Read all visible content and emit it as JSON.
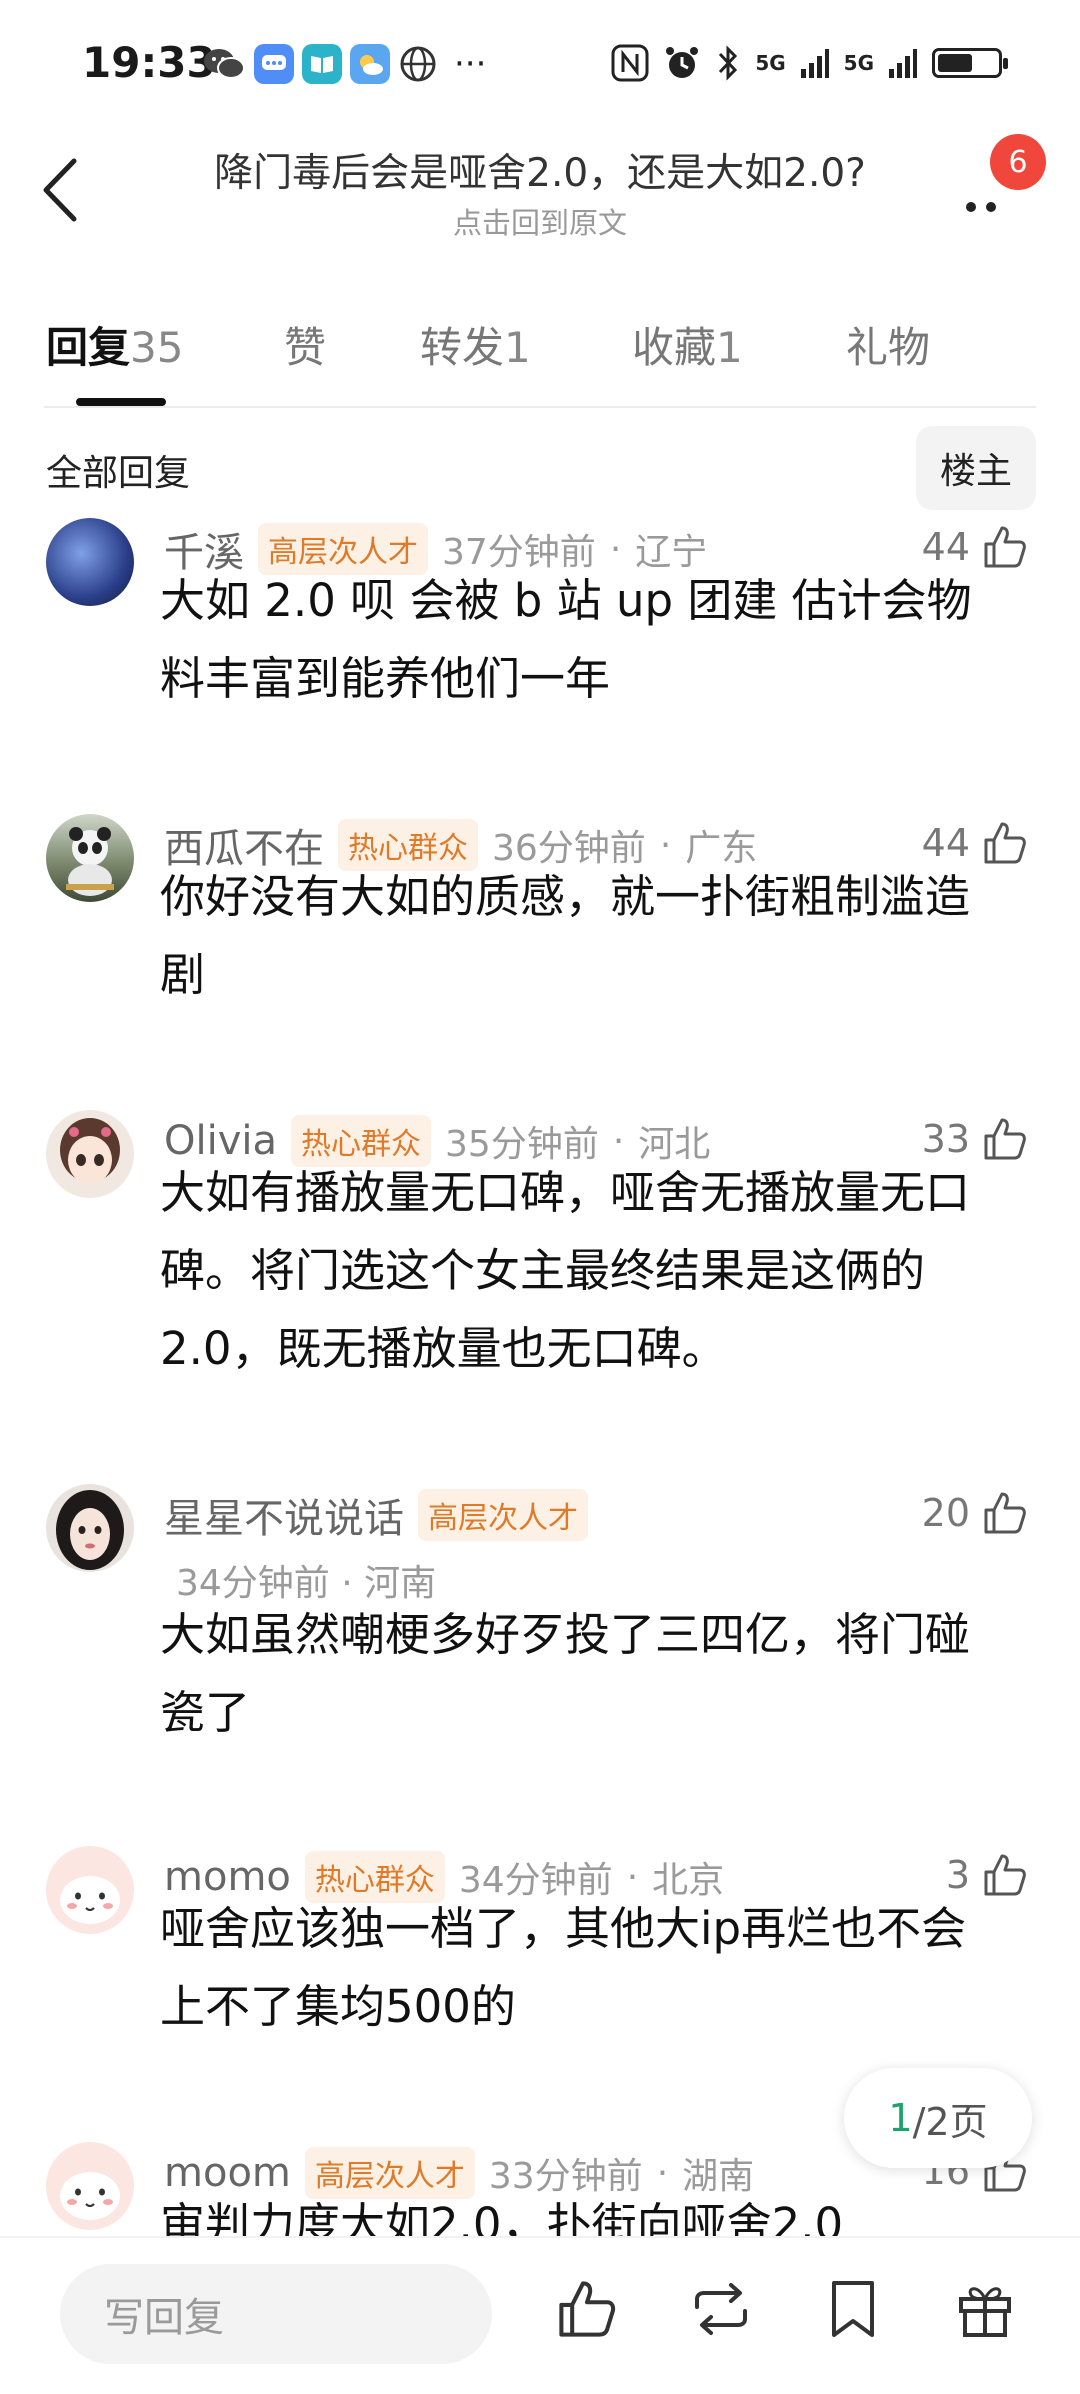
{
  "status_bar": {
    "time": "19:33",
    "dots": "···",
    "signal1": "5G",
    "signal2": "5G"
  },
  "header": {
    "title": "降门毒后会是哑舍2.0，还是大如2.0?",
    "subtitle": "点击回到原文",
    "notification_count": "6"
  },
  "tabs": [
    {
      "label": "回复",
      "count": "35"
    },
    {
      "label": "赞",
      "count": ""
    },
    {
      "label": "转发",
      "count": "1"
    },
    {
      "label": "收藏",
      "count": "1"
    },
    {
      "label": "礼物",
      "count": ""
    }
  ],
  "filter": {
    "all_replies": "全部回复",
    "op_only": "楼主"
  },
  "comments": [
    {
      "name": "千溪",
      "rank": "高层次人才",
      "time": "37分钟前",
      "location": "辽宁",
      "likes": "44",
      "lines": [
        "大如 2.0 呗 会被 b 站 up 团建 估计会物",
        "料丰富到能养他们一年"
      ]
    },
    {
      "name": "西瓜不在",
      "rank": "热心群众",
      "time": "36分钟前",
      "location": "广东",
      "likes": "44",
      "lines": [
        "你好没有大如的质感，就一扑街粗制滥造",
        "剧"
      ]
    },
    {
      "name": "Olivia",
      "rank": "热心群众",
      "time": "35分钟前",
      "location": "河北",
      "likes": "33",
      "lines": [
        "大如有播放量无口碑，哑舍无播放量无口",
        "碑。将门选这个女主最终结果是这俩的",
        "2.0，既无播放量也无口碑。"
      ]
    },
    {
      "name": "星星不说说话",
      "rank": "高层次人才",
      "time": "34分钟前",
      "location": "河南",
      "likes": "20",
      "lines": [
        "大如虽然嘲梗多好歹投了三四亿，将门碰",
        "瓷了"
      ]
    },
    {
      "name": "momo",
      "rank": "热心群众",
      "time": "34分钟前",
      "location": "北京",
      "likes": "3",
      "lines": [
        "哑舍应该独一档了，其他大ip再烂也不会",
        "上不了集均500的"
      ]
    },
    {
      "name": "moom",
      "rank": "高层次人才",
      "time": "33分钟前",
      "location": "湖南",
      "likes": "16",
      "lines": [
        "审判力度大如2.0，扑街向哑舍2.0"
      ]
    }
  ],
  "pager": {
    "current": "1",
    "total": "/2页"
  },
  "bottom_bar": {
    "reply_placeholder": "写回复"
  },
  "colors": {
    "rank_text": "#e07a28",
    "rank_bg": "#fdf1e6",
    "badge": "#f0463c",
    "pager_current": "#1aa36a"
  }
}
